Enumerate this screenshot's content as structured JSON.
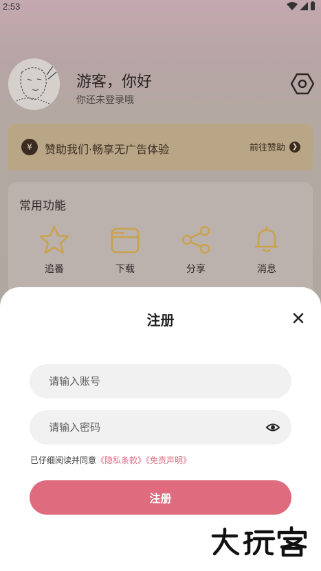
{
  "status_bar": {
    "time": "2:53"
  },
  "profile": {
    "greeting": "游客，你好",
    "subtext": "你还未登录哦"
  },
  "sponsor": {
    "yen": "¥",
    "title": "赞助我们·畅享无广告体验",
    "go_label": "前往赞助"
  },
  "functions": {
    "title": "常用功能",
    "items": [
      {
        "label": "追番",
        "icon": "star-icon"
      },
      {
        "label": "下载",
        "icon": "folder-icon"
      },
      {
        "label": "分享",
        "icon": "share-icon"
      },
      {
        "label": "消息",
        "icon": "bell-icon"
      }
    ]
  },
  "register": {
    "title": "注册",
    "account_placeholder": "请输入账号",
    "password_placeholder": "请输入密码",
    "agree_prefix": "已仔细阅读并同意",
    "privacy_link": "《隐私条款》",
    "disclaimer_link": "《免责声明》",
    "submit_label": "注册"
  },
  "colors": {
    "accent": "#df6b7f",
    "link": "#e06b82",
    "sponsor_bg": "#b9a686"
  }
}
